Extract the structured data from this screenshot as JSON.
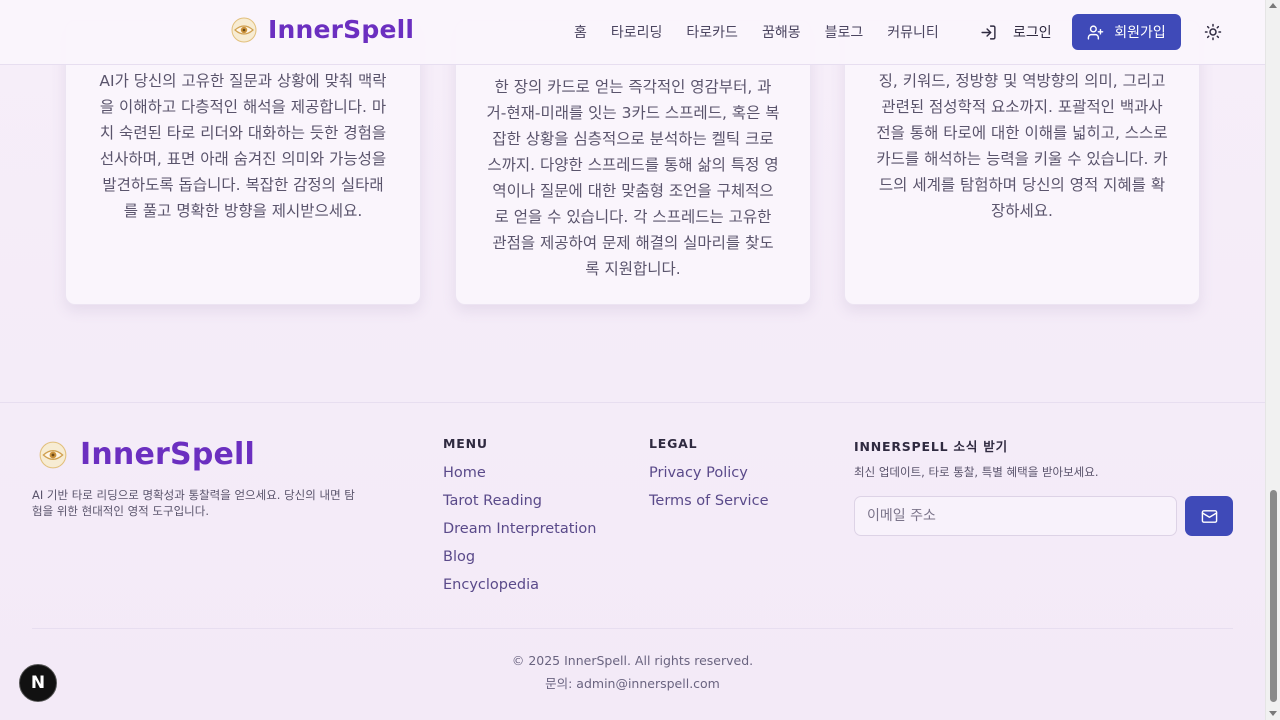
{
  "header": {
    "brand": "InnerSpell",
    "nav": [
      "홈",
      "타로리딩",
      "타로카드",
      "꿈해몽",
      "블로그",
      "커뮤니티"
    ],
    "login_label": "로그인",
    "signup_label": "회원가입"
  },
  "cards": [
    {
      "text": "AI가 당신의 고유한 질문과 상황에 맞춰 맥락을 이해하고 다층적인 해석을 제공합니다. 마치 숙련된 타로 리더와 대화하는 듯한 경험을 선사하며, 표면 아래 숨겨진 의미와 가능성을 발견하도록 돕습니다. 복잡한 감정의 실타래를 풀고 명확한 방향을 제시받으세요."
    },
    {
      "text": "한 장의 카드로 얻는 즉각적인 영감부터, 과거-현재-미래를 잇는 3카드 스프레드, 혹은 복잡한 상황을 심층적으로 분석하는 켈틱 크로스까지. 다양한 스프레드를 통해 삶의 특정 영역이나 질문에 대한 맞춤형 조언을 구체적으로 얻을 수 있습니다. 각 스프레드는 고유한 관점을 제공하여 문제 해결의 실마리를 찾도록 지원합니다."
    },
    {
      "text": "징, 키워드, 정방향 및 역방향의 의미, 그리고 관련된 점성학적 요소까지. 포괄적인 백과사전을 통해 타로에 대한 이해를 넓히고, 스스로 카드를 해석하는 능력을 키울 수 있습니다. 카드의 세계를 탐험하며 당신의 영적 지혜를 확장하세요."
    }
  ],
  "footer": {
    "brand": "InnerSpell",
    "description": "AI 기반 타로 리딩으로 명확성과 통찰력을 얻으세요. 당신의 내면 탐험을 위한 현대적인 영적 도구입니다.",
    "menu_title": "MENU",
    "menu": [
      "Home",
      "Tarot Reading",
      "Dream Interpretation",
      "Blog",
      "Encyclopedia"
    ],
    "legal_title": "LEGAL",
    "legal": [
      "Privacy Policy",
      "Terms of Service"
    ],
    "newsletter_title": "INNERSPELL 소식 받기",
    "newsletter_desc": "최신 업데이트, 타로 통찰, 특별 혜택을 받아보세요.",
    "email_placeholder": "이메일 주소",
    "copyright": "© 2025 InnerSpell. All rights reserved.",
    "contact": "문의: admin@innerspell.com"
  },
  "badge": "N",
  "colors": {
    "brand": "#6b2fc0",
    "button": "#3f4ab8",
    "background": "#f6eef9"
  }
}
